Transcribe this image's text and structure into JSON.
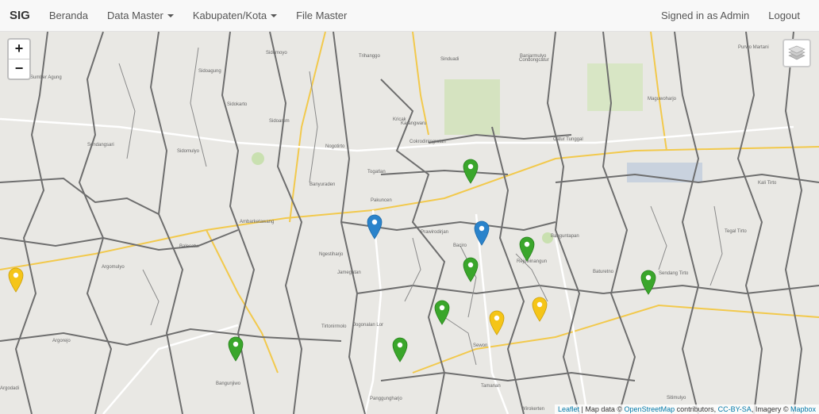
{
  "navbar": {
    "brand": "SIG",
    "items": [
      {
        "label": "Beranda",
        "dropdown": false
      },
      {
        "label": "Data Master",
        "dropdown": true
      },
      {
        "label": "Kabupaten/Kota",
        "dropdown": true
      },
      {
        "label": "File Master",
        "dropdown": false
      }
    ],
    "user": "Signed in as Admin",
    "logout": "Logout"
  },
  "map": {
    "zoom_in": "+",
    "zoom_out": "−",
    "place_labels": [
      "Sidomoyo",
      "Trihanggo",
      "Sinduadi",
      "Banjarmulyo",
      "Condongcatur",
      "Purwo Martani",
      "Sumber Agung",
      "Sidoagung",
      "Sidokarto",
      "Sidoarum",
      "Sidomulyo",
      "Nogotirto",
      "Banyuraden",
      "Sendangsari",
      "Togatlan",
      "Pakuncen",
      "Kricak",
      "Karangwaru",
      "Cokrodiningratan",
      "Catur Tunggal",
      "Maguwoharjo",
      "Kali Tirto",
      "Ambarketawang",
      "Balecatur",
      "Argomulyo",
      "Ngestiharjo",
      "Jamegatan",
      "Prawirodirjan",
      "Baciro",
      "Rejowinangun",
      "Banguntapan",
      "Tegal Tirto",
      "Sendang Tirto",
      "Bangunjiwo",
      "Panggungharjo",
      "Sewon",
      "Tamanan",
      "Wirokerten",
      "Argorejo",
      "Argodadi",
      "Tirtonirmolo",
      "Jogonalan Lor",
      "Baturetno",
      "Sitimulyo"
    ],
    "markers": [
      {
        "color": "green"
      },
      {
        "color": "blue"
      },
      {
        "color": "blue"
      },
      {
        "color": "green"
      },
      {
        "color": "green"
      },
      {
        "color": "yellow"
      },
      {
        "color": "green"
      },
      {
        "color": "yellow"
      },
      {
        "color": "yellow"
      },
      {
        "color": "green"
      },
      {
        "color": "green"
      },
      {
        "color": "green"
      }
    ],
    "colors": {
      "green": "#3aa62b",
      "blue": "#2a83cb",
      "yellow": "#f5c518",
      "boundary": "#6e6e6e",
      "road": "#f2c94c"
    },
    "attribution": {
      "leaflet": "Leaflet",
      "text1": " | Map data © ",
      "osm": "OpenStreetMap",
      "text2": " contributors, ",
      "license": "CC-BY-SA",
      "text3": ", Imagery © ",
      "mapbox": "Mapbox"
    }
  }
}
